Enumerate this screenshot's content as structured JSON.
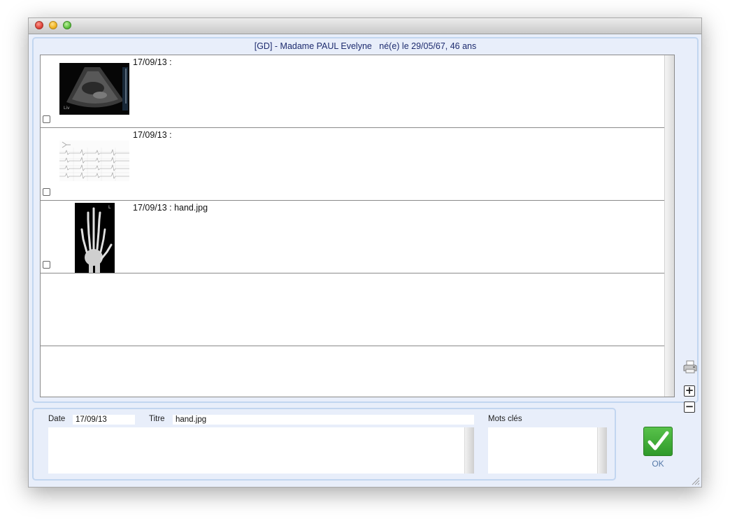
{
  "window": {
    "close_icon": "close-icon",
    "minimize_icon": "minimize-icon",
    "zoom_icon": "zoom-icon"
  },
  "header": {
    "patient_line": "[GD] - Madame PAUL Evelyne   né(e) le 29/05/67, 46 ans"
  },
  "documents": [
    {
      "caption": "17/09/13 :",
      "thumbnail": "ultrasound-image",
      "checked": false
    },
    {
      "caption": "17/09/13 :",
      "thumbnail": "ecg-image",
      "checked": false
    },
    {
      "caption": "17/09/13 : hand.jpg",
      "thumbnail": "hand-xray-image",
      "checked": false
    }
  ],
  "side_tools": {
    "print_icon": "printer-icon",
    "zoom_in_label": "+",
    "zoom_out_label": "−"
  },
  "details": {
    "date_label": "Date",
    "date_value": "17/09/13",
    "title_label": "Titre",
    "title_value": "hand.jpg",
    "keywords_label": "Mots clés"
  },
  "ok_button": {
    "label": "OK",
    "icon": "checkmark-icon",
    "color": "#3aa832"
  }
}
